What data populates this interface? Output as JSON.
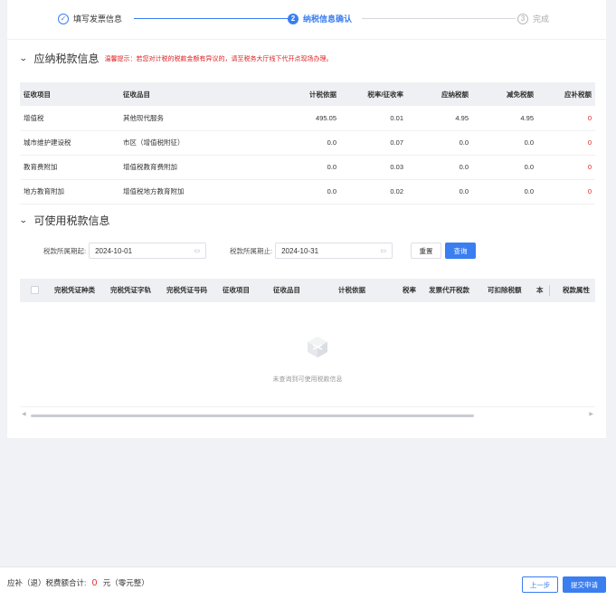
{
  "steps": [
    {
      "num": "✓",
      "label": "填写发票信息"
    },
    {
      "num": "2",
      "label": "纳税信息确认"
    },
    {
      "num": "3",
      "label": "完成"
    }
  ],
  "payable_section": {
    "title": "应纳税款信息",
    "tip": "温馨提示：若您对计税的税款金额有异议的，请至税务大厅线下代开点现场办理。",
    "headers": [
      "征收项目",
      "征收品目",
      "计税依据",
      "税率/征收率",
      "应纳税额",
      "减免税额",
      "应补税额"
    ],
    "rows": [
      [
        "增值税",
        "其他现代服务",
        "495.05",
        "0.01",
        "4.95",
        "4.95",
        "0"
      ],
      [
        "城市维护建设税",
        "市区（增值税附征）",
        "0.0",
        "0.07",
        "0.0",
        "0.0",
        "0"
      ],
      [
        "教育费附加",
        "增值税教育费附加",
        "0.0",
        "0.03",
        "0.0",
        "0.0",
        "0"
      ],
      [
        "地方教育附加",
        "增值税地方教育附加",
        "0.0",
        "0.02",
        "0.0",
        "0.0",
        "0"
      ]
    ]
  },
  "available_section": {
    "title": "可使用税款信息",
    "filter_start_label": "税款所属期起:",
    "filter_start_value": "2024-10-01",
    "filter_end_label": "税款所属期止:",
    "filter_end_value": "2024-10-31",
    "reset_label": "重置",
    "query_label": "查询",
    "headers": [
      "完税凭证种类",
      "完税凭证字轨",
      "完税凭证号码",
      "征收项目",
      "征收品目",
      "计税依据",
      "税率",
      "发票代开税款",
      "可扣除税额",
      "本",
      "税款属性"
    ],
    "empty_text": "未查询到可使用税款信息"
  },
  "footer": {
    "sum_label": "应补（退）税费额合计:",
    "sum_amount": "0",
    "sum_unit": "元（零元整）",
    "prev_label": "上一步",
    "submit_label": "提交申请"
  },
  "colors": {
    "accent": "#3a7ef0",
    "warning": "#e02020"
  }
}
